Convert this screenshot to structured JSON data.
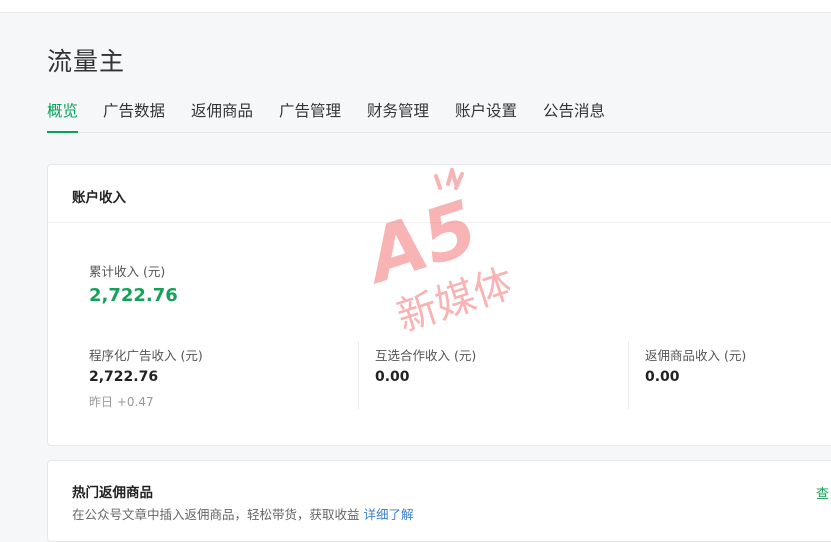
{
  "page": {
    "title": "流量主"
  },
  "tabs": [
    {
      "label": "概览"
    },
    {
      "label": "广告数据"
    },
    {
      "label": "返佣商品"
    },
    {
      "label": "广告管理"
    },
    {
      "label": "财务管理"
    },
    {
      "label": "账户设置"
    },
    {
      "label": "公告消息"
    }
  ],
  "income": {
    "title": "账户收入",
    "total_label": "累计收入 (元)",
    "total_value": "2,722.76",
    "stats": [
      {
        "label": "程序化广告收入 (元)",
        "value": "2,722.76",
        "sub": "昨日 +0.47"
      },
      {
        "label": "互选合作收入 (元)",
        "value": "0.00"
      },
      {
        "label": "返佣商品收入 (元)",
        "value": "0.00"
      }
    ]
  },
  "hot": {
    "title": "热门返佣商品",
    "desc": "在公众号文章中插入返佣商品，轻松带货，获取收益",
    "link": "详细了解",
    "right_text": "查"
  },
  "watermark": {
    "top_text": "A5",
    "bottom_text": "新媒体"
  },
  "colors": {
    "accent": "#07a15a",
    "value_green": "#16a05a",
    "link": "#3b7ed3",
    "watermark": "#f15a5a"
  }
}
